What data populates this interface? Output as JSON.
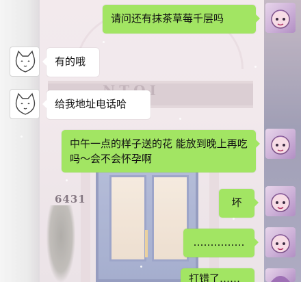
{
  "chat": {
    "messages": [
      {
        "id": "m1",
        "side": "me",
        "text": "请问还有抹茶草莓千层吗"
      },
      {
        "id": "m2",
        "side": "shop",
        "text": "有的哦"
      },
      {
        "id": "m3",
        "side": "shop",
        "text": "给我地址电话哈"
      },
      {
        "id": "m4",
        "side": "me",
        "text": "中午一点的样子送的花 能放到晚上再吃吗～会不会怀孕啊"
      },
      {
        "id": "m5",
        "side": "me",
        "text": "坏"
      },
      {
        "id": "m6",
        "side": "me",
        "text": "……………"
      },
      {
        "id": "m7",
        "side": "me",
        "text": "打错了……"
      }
    ]
  },
  "background": {
    "storefront_sign": "NTOI",
    "house_number": "6431"
  },
  "colors": {
    "bubble_out": "#a2e563",
    "bubble_in": "#ffffff",
    "text": "#111111"
  },
  "icons": {
    "shop_avatar": "white-cat-avatar-icon",
    "me_avatar": "cartoon-girl-avatar-icon"
  }
}
